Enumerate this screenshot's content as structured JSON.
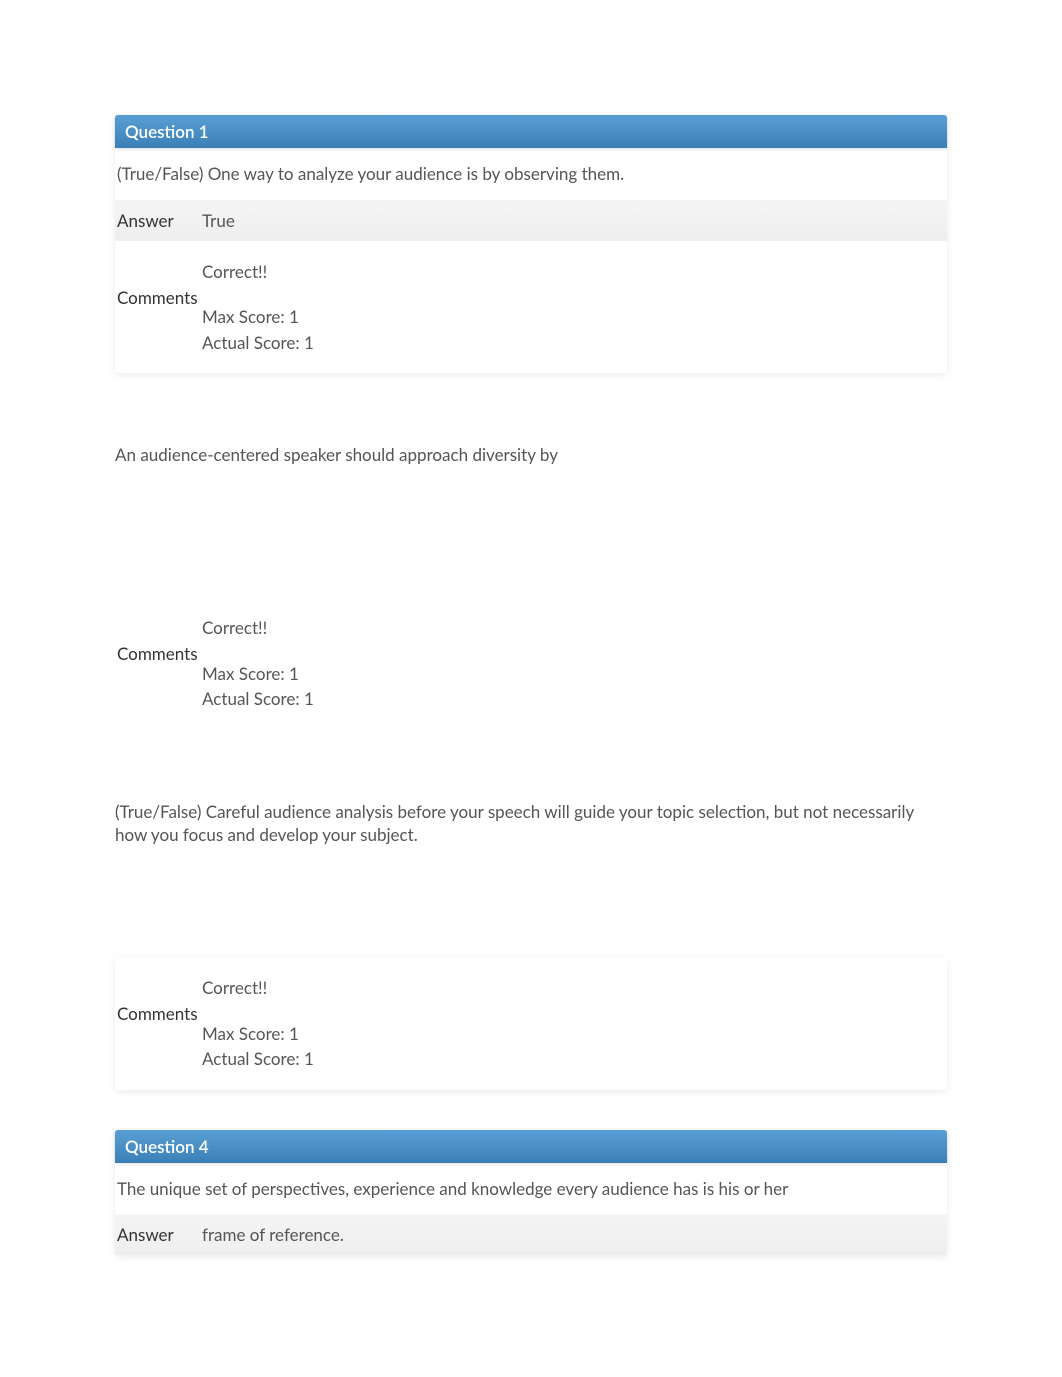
{
  "questions": [
    {
      "header": "Question 1",
      "text": "(True/False) One way to analyze your audience is by observing them.",
      "answer_label": "Answer",
      "answer_value": "True",
      "comments_label": "Comments",
      "correct": "Correct!!",
      "max_score": "Max Score: 1",
      "actual_score": "Actual Score: 1"
    },
    {
      "text": "An audience-centered speaker should approach diversity by",
      "comments_label": "Comments",
      "correct": "Correct!!",
      "max_score": "Max Score: 1",
      "actual_score": "Actual Score: 1"
    },
    {
      "text": "(True/False) Careful audience analysis before your speech will guide your topic selection, but not necessarily how you focus and develop your subject.",
      "comments_label": "Comments",
      "correct": "Correct!!",
      "max_score": "Max Score: 1",
      "actual_score": "Actual Score: 1"
    },
    {
      "header": "Question 4",
      "text": "The unique set of perspectives, experience and knowledge every audience has is his or her",
      "answer_label": "Answer",
      "answer_value": "frame of reference."
    }
  ]
}
